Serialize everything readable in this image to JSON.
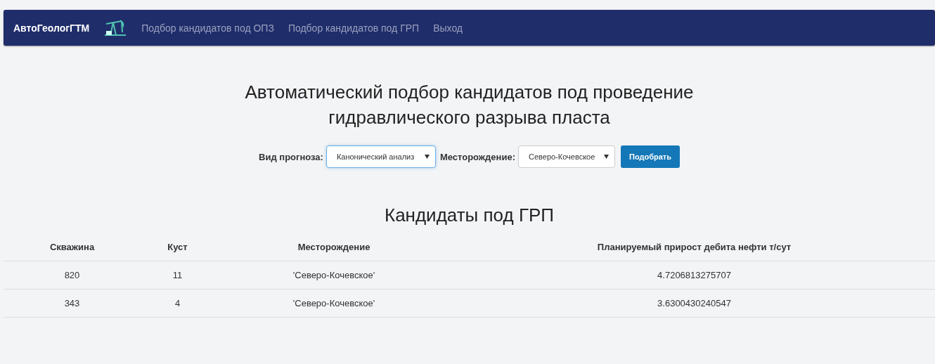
{
  "navbar": {
    "brand": "АвтоГеологГТМ",
    "links": [
      {
        "label": "Подбор кандидатов под ОПЗ",
        "selected": false
      },
      {
        "label": "Подбор кандидатов под ГРП",
        "selected": false
      },
      {
        "label": "Выход",
        "selected": false
      }
    ]
  },
  "title_lines": [
    "Автоматический подбор кандидатов под проведение",
    "гидравлического разрыва пласта"
  ],
  "form": {
    "fields": [
      {
        "label": "Вид прогноза:",
        "value": "Канонический анализ",
        "focused": true
      },
      {
        "label": "Месторождение:",
        "value": "Северо-Кочевское",
        "focused": false
      }
    ],
    "button": "Подобрать"
  },
  "table": {
    "title": "Кандидаты под ГРП",
    "columns": [
      "Скважина",
      "Куст",
      "Месторождение",
      "Планируемый прирост дебита нефти т/сут"
    ],
    "rows": [
      [
        "820",
        "11",
        "'Северо-Кочевское'",
        "4.7206813275707"
      ],
      [
        "343",
        "4",
        "'Северо-Кочевское'",
        "3.6300430240547"
      ]
    ]
  }
}
